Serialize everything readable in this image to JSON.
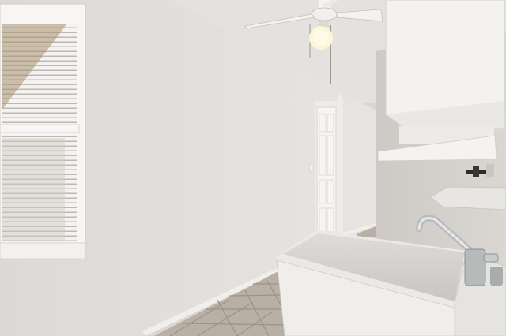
{
  "scene": {
    "kind": "photo",
    "subject": "laundry-room",
    "colors": {
      "left_wall": "#e3e0dd",
      "back_wall": "#d7d4d1",
      "ceiling": "#e6e3e0",
      "floor_tile": "#b7aea3",
      "grout": "#9b9187",
      "door": "#f6f5f2",
      "cabinet": "#f3f2f0",
      "sink": "#ecebe8",
      "faucet": "#b9bcbe",
      "blinds": "#f4f3f1",
      "window_frame": "#f7f6f4",
      "baseboard": "#f1efec"
    },
    "icons": [
      "ceiling-fan-icon",
      "light-bulb-icon",
      "faucet-icon"
    ]
  }
}
